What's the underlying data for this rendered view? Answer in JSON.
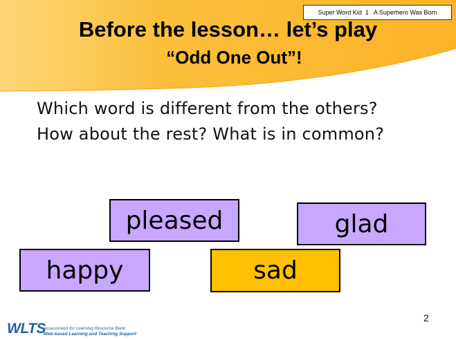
{
  "header": {
    "tag": "Super Word Kid  1   A Superhero Was Born",
    "title_line1": "Before the lesson… let’s play",
    "title_line2": "“Odd One Out”!",
    "colors": {
      "banner": "#fbb930",
      "banner_light": "#fcd778"
    }
  },
  "questions": {
    "line1": "Which word is different from the others?",
    "line2": "How about the rest? What is in common?"
  },
  "cards": {
    "pleased": "pleased",
    "glad": "glad",
    "happy": "happy",
    "sad": "sad",
    "colors": {
      "odd": "#ffc000",
      "common": "#c8a7ff"
    }
  },
  "footer": {
    "page_number": "2",
    "logo_mark": "WLTS",
    "logo_line1": "Assessment for Learning Resource Bank",
    "logo_line2": "Web-based Learning and Teaching Support"
  }
}
